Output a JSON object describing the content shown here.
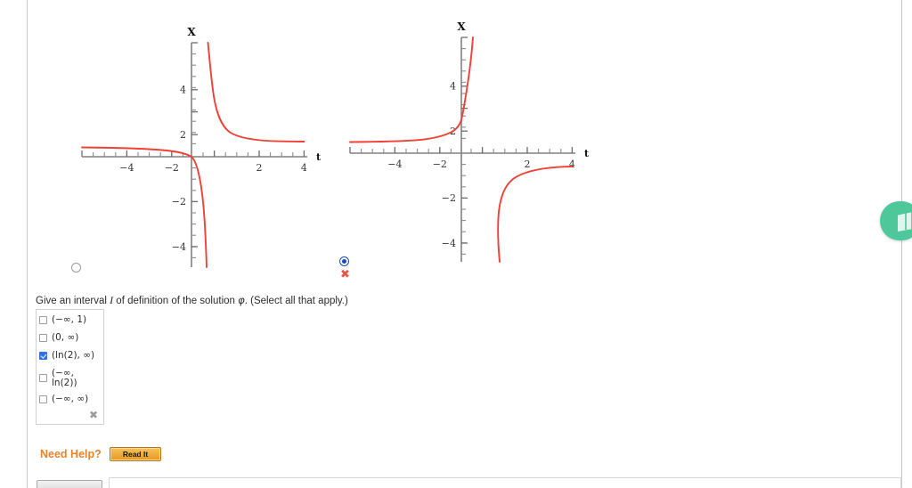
{
  "page": {
    "background": "#ffffff",
    "accent_orange": "#e8832a",
    "curve_color": "#ef4136",
    "axis_color": "#808080",
    "checked_color": "#2f72e8",
    "incorrect_color": "#e8564a",
    "side_tab_color": "#4ec79b"
  },
  "question": {
    "prefix": "Give an interval ",
    "symbol_I": "I",
    "middle": " of definition of the solution ",
    "symbol_phi": "φ",
    "suffix": ". (Select all that apply.)"
  },
  "choices": [
    {
      "label": "(−∞, 1)",
      "checked": false
    },
    {
      "label": "(0, ∞)",
      "checked": false
    },
    {
      "label": "(ln(2), ∞)",
      "checked": true
    },
    {
      "label": "(−∞,\nln(2))",
      "line1": "(−∞,",
      "line2": "ln(2))",
      "checked": false
    },
    {
      "label": "(−∞, ∞)",
      "checked": false
    }
  ],
  "choice_clear": {
    "icon": "clear-x-icon",
    "glyph": "✖"
  },
  "graphs": [
    {
      "id": "graph-option-1",
      "selected": false,
      "marked_incorrect": false,
      "x_axis_label": "t",
      "y_axis_label": "X",
      "x_ticks": [
        "−4",
        "−2",
        "2",
        "4"
      ],
      "y_ticks": [
        "4",
        "2",
        "−2",
        "−4"
      ],
      "xlim": [
        -5,
        5
      ],
      "ylim": [
        -5,
        5
      ]
    },
    {
      "id": "graph-option-2",
      "selected": true,
      "marked_incorrect": true,
      "x_axis_label": "t",
      "y_axis_label": "X",
      "x_ticks": [
        "−4",
        "−2",
        "2",
        "4"
      ],
      "y_ticks": [
        "4",
        "2",
        "−2",
        "−4"
      ],
      "xlim": [
        -5,
        5
      ],
      "ylim": [
        -5,
        5
      ]
    }
  ],
  "help": {
    "label": "Need Help?",
    "button_label": "Read It"
  },
  "side_tab": {
    "icon": "book-icon"
  }
}
